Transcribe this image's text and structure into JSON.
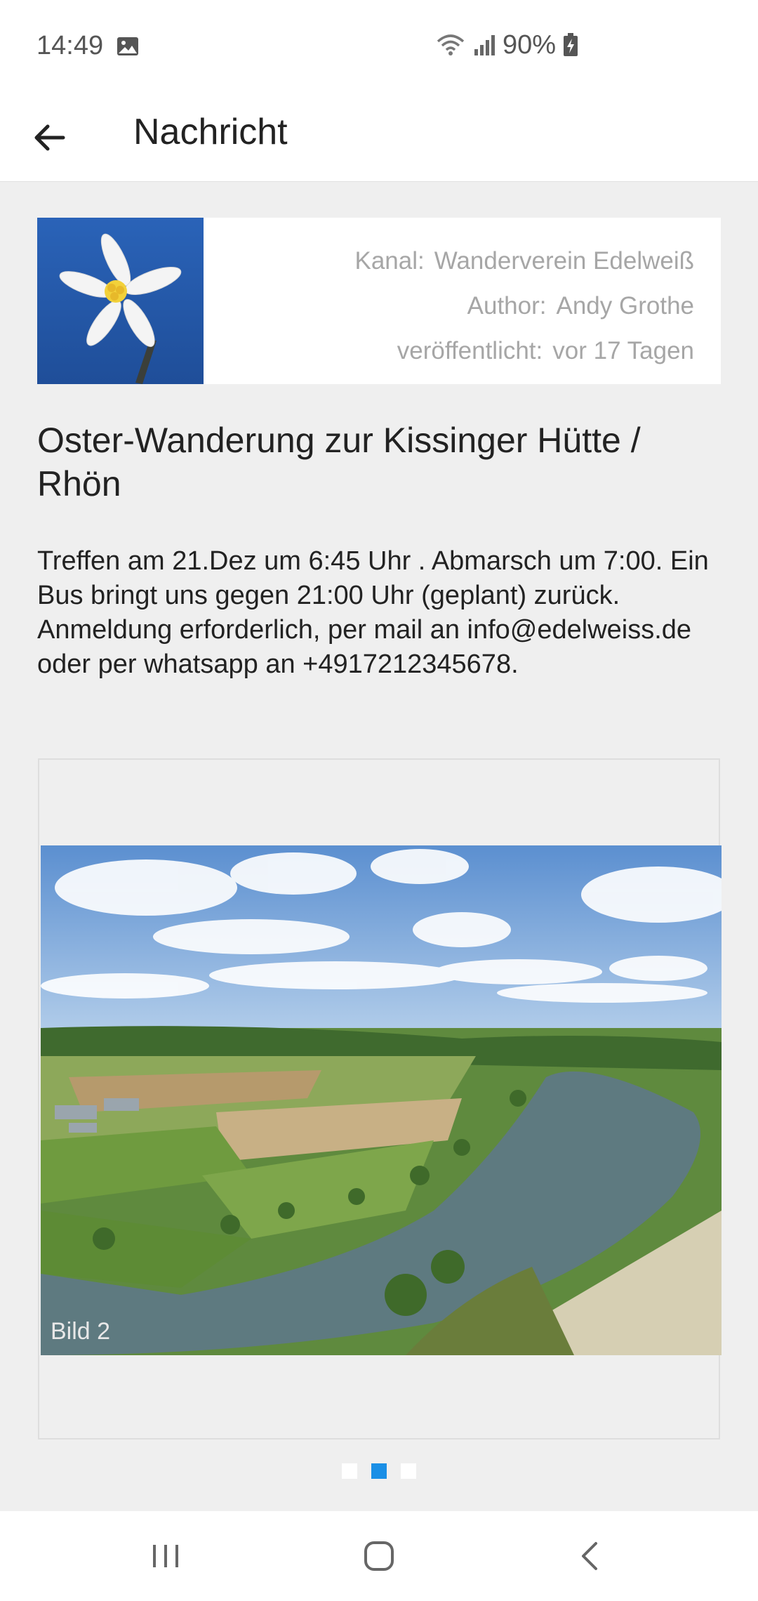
{
  "status_bar": {
    "time": "14:49",
    "battery": "90%"
  },
  "app_bar": {
    "title": "Nachricht"
  },
  "post": {
    "channel_label": "Kanal:",
    "channel": "Wanderverein Edelweiß",
    "author_label": "Author:",
    "author": "Andy Grothe",
    "published_label": "veröffentlicht:",
    "published": "vor 17 Tagen",
    "title": "Oster-Wanderung zur Kissinger Hütte / Rhön",
    "body": "Treffen am 21.Dez um 6:45 Uhr . Abmarsch um 7:00. Ein Bus bringt uns gegen 21:00 Uhr (geplant) zurück. Anmeldung erforderlich, per mail an info@edelweiss.de oder per whatsapp an +4917212345678."
  },
  "gallery": {
    "caption": "Bild 2",
    "page_count": 3,
    "active_index": 1
  },
  "colors": {
    "accent": "#1a8fe6",
    "background": "#efefef"
  }
}
